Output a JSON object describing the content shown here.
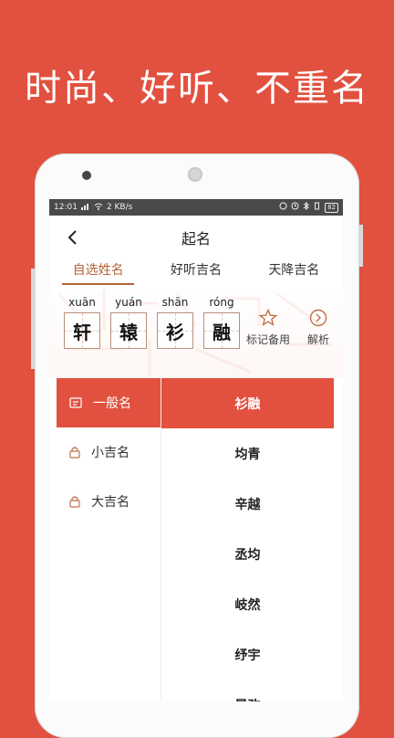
{
  "headline": "时尚、好听、不重名",
  "status": {
    "time": "12:01",
    "net": "2 KB/s",
    "battery": "82"
  },
  "header": {
    "title": "起名"
  },
  "tabs": [
    {
      "label": "自选姓名",
      "active": true
    },
    {
      "label": "好听吉名",
      "active": false
    },
    {
      "label": "天降吉名",
      "active": false
    }
  ],
  "name": [
    {
      "pinyin": "xuān",
      "char": "轩"
    },
    {
      "pinyin": "yuán",
      "char": "辕"
    },
    {
      "pinyin": "shān",
      "char": "衫"
    },
    {
      "pinyin": "róng",
      "char": "融"
    }
  ],
  "actions": {
    "bookmark": "标记备用",
    "analyze": "解析"
  },
  "categories": [
    {
      "label": "一般名",
      "icon": "note-icon",
      "active": true
    },
    {
      "label": "小吉名",
      "icon": "lock-icon",
      "active": false
    },
    {
      "label": "大吉名",
      "icon": "lock-icon",
      "active": false
    }
  ],
  "names": [
    "衫融",
    "均青",
    "辛越",
    "丞均",
    "岐然",
    "纾宇",
    "昇孜"
  ],
  "colors": {
    "accent": "#e2513f",
    "tab_active": "#b5653a"
  }
}
